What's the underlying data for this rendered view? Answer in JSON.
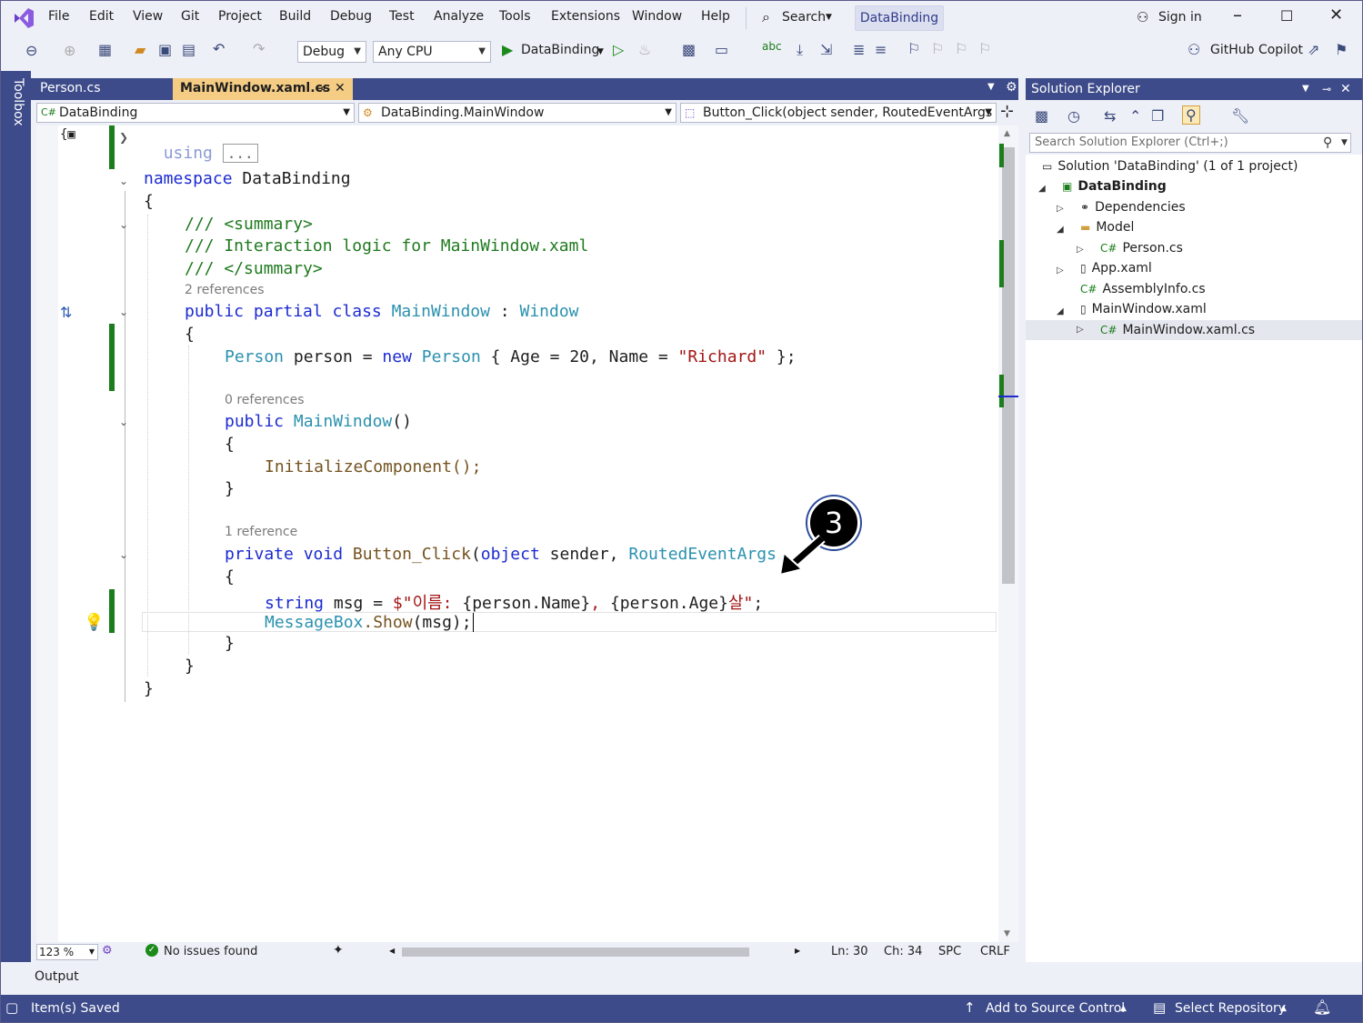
{
  "menu": {
    "items": [
      "File",
      "Edit",
      "View",
      "Git",
      "Project",
      "Build",
      "Debug",
      "Test",
      "Analyze",
      "Tools",
      "Extensions",
      "Window",
      "Help"
    ],
    "search_label": "Search",
    "solution_chip": "DataBinding",
    "sign_in": "Sign in"
  },
  "toolbar": {
    "config": "Debug",
    "platform": "Any CPU",
    "run_target": "DataBinding",
    "copilot": "GitHub Copilot"
  },
  "toolbox_label": "Toolbox",
  "doc_tabs": [
    {
      "label": "Person.cs",
      "active": false
    },
    {
      "label": "MainWindow.xaml.cs",
      "active": true
    }
  ],
  "nav": {
    "project": "DataBinding",
    "type": "DataBinding.MainWindow",
    "member": "Button_Click(object sender, RoutedEventArgs e)"
  },
  "code": {
    "using_kw": "using",
    "using_collapsed": "...",
    "namespace_kw": "namespace",
    "namespace_name": "DataBinding",
    "brace_open": "{",
    "brace_close": "}",
    "summary_open": "/// <summary>",
    "summary_text": "/// Interaction logic for MainWindow.xaml",
    "summary_close": "/// </summary>",
    "class_refs": "2 references",
    "class_kw": "public partial class",
    "class_name": "MainWindow",
    "class_colon": " : ",
    "class_base": "Window",
    "field_type": "Person",
    "field_rest": " person = ",
    "field_new": "new",
    "field_type2": "Person",
    "field_init1": " { Age = 20, Name = ",
    "field_str": "\"Richard\"",
    "field_end": " };",
    "ctor_refs": "0 references",
    "ctor_kw": "public",
    "ctor_name": "MainWindow",
    "ctor_parens": "()",
    "init_call": "InitializeComponent();",
    "method_refs": "1 reference",
    "method_kw": "private void",
    "method_name": "Button_Click",
    "method_p1": "(",
    "method_obj": "object",
    "method_sender": " sender, ",
    "method_argtype": "RoutedEventArgs",
    "string_kw": "string",
    "msg_decl": " msg = ",
    "interp_start": "$\"이름: ",
    "interp_mid1": "{person.Name}",
    "interp_sep": ", ",
    "interp_mid2": "{person.Age}",
    "interp_end": "살\"",
    "semicolon": ";",
    "msgbox_type": "MessageBox",
    "msgbox_call": ".Show",
    "msgbox_args": "(msg);"
  },
  "callout_number": "3",
  "editor_status": {
    "zoom": "123 %",
    "issues": "No issues found",
    "line": "Ln: 30",
    "col": "Ch: 34",
    "spc": "SPC",
    "eol": "CRLF"
  },
  "output_label": "Output",
  "statusbar": {
    "saved": "Item(s) Saved",
    "source_control": "Add to Source Control",
    "repository": "Select Repository"
  },
  "solution_explorer": {
    "title": "Solution Explorer",
    "search_placeholder": "Search Solution Explorer (Ctrl+;)",
    "items": [
      {
        "label": "Solution 'DataBinding' (1 of 1 project)",
        "icon": "solution-icon"
      },
      {
        "label": "DataBinding",
        "icon": "csharp-project-icon"
      },
      {
        "label": "Dependencies",
        "icon": "dependencies-icon"
      },
      {
        "label": "Model",
        "icon": "folder-icon"
      },
      {
        "label": "Person.cs",
        "icon": "csharp-file-icon"
      },
      {
        "label": "App.xaml",
        "icon": "xaml-file-icon"
      },
      {
        "label": "AssemblyInfo.cs",
        "icon": "csharp-file-icon"
      },
      {
        "label": "MainWindow.xaml",
        "icon": "xaml-file-icon"
      },
      {
        "label": "MainWindow.xaml.cs",
        "icon": "csharp-file-icon"
      }
    ]
  },
  "colors": {
    "accent": "#3d4b8a",
    "active_tab": "#f5cc84",
    "keyword": "#1c2bd0",
    "type": "#2b91af",
    "comment": "#1f7a1f",
    "string": "#a31515",
    "change_bar": "#1b7d1b"
  }
}
